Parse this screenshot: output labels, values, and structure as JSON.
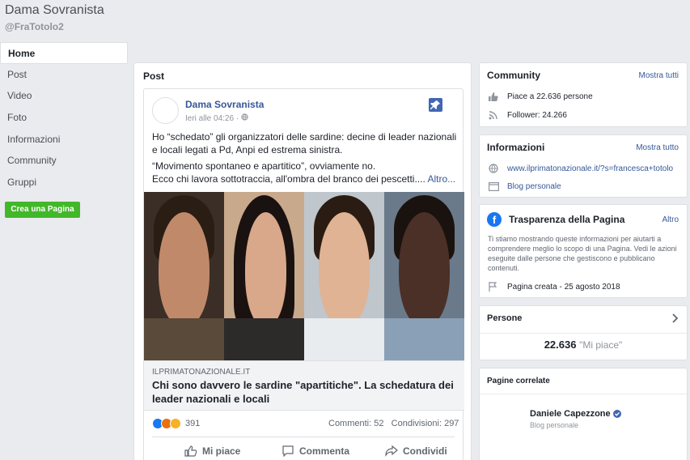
{
  "page": {
    "title": "Dama Sovranista",
    "handle": "@FraTotolo2"
  },
  "nav": {
    "items": [
      "Home",
      "Post",
      "Video",
      "Foto",
      "Informazioni",
      "Community",
      "Gruppi"
    ],
    "create_button": "Crea una Pagina"
  },
  "main": {
    "header": "Post",
    "post": {
      "author": "Dama Sovranista",
      "time": "Ieri alle 04:26 ·",
      "text1": "Ho “schedato” gli organizzatori delle sardine: decine di leader nazionali e locali legati a Pd, Anpi ed estrema sinistra.",
      "text2": "“Movimento spontaneo e apartitico”, ovviamente no.",
      "text3": "Ecco chi lavora sottotraccia, all'ombra del branco dei pescetti....",
      "more": "Altro...",
      "link_domain": "ILPRIMATONAZIONALE.IT",
      "link_title": "Chi sono davvero le sardine \"apartitiche\". La schedatura dei leader nazionali e locali",
      "reactions_count": "391",
      "comments": "Commenti: 52",
      "shares": "Condivisioni: 297",
      "actions": {
        "like": "Mi piace",
        "comment": "Commenta",
        "share": "Condividi"
      }
    }
  },
  "sidebar": {
    "community": {
      "title": "Community",
      "link": "Mostra tutti",
      "likes": "Piace a 22.636 persone",
      "followers": "Follower: 24.266"
    },
    "info": {
      "title": "Informazioni",
      "link": "Mostra tutto",
      "website": "www.ilprimatonazionale.it/?s=francesca+totolo",
      "category": "Blog personale"
    },
    "transparency": {
      "title": "Trasparenza della Pagina",
      "link": "Altro",
      "text": "Ti stiamo mostrando queste informazioni per aiutarti a comprendere meglio lo scopo di una Pagina. Vedi le azioni eseguite dalle persone che gestiscono e pubblicano contenuti.",
      "created": "Pagina creata - 25 agosto 2018"
    },
    "people": {
      "title": "Persone",
      "count": "22.636",
      "count_label": "\"Mi piace\""
    },
    "related": {
      "title": "Pagine correlate",
      "name": "Daniele Capezzone",
      "category": "Blog personale"
    }
  },
  "colors": {
    "accent": "#4267b2",
    "link": "#365899",
    "green": "#42b72a"
  }
}
